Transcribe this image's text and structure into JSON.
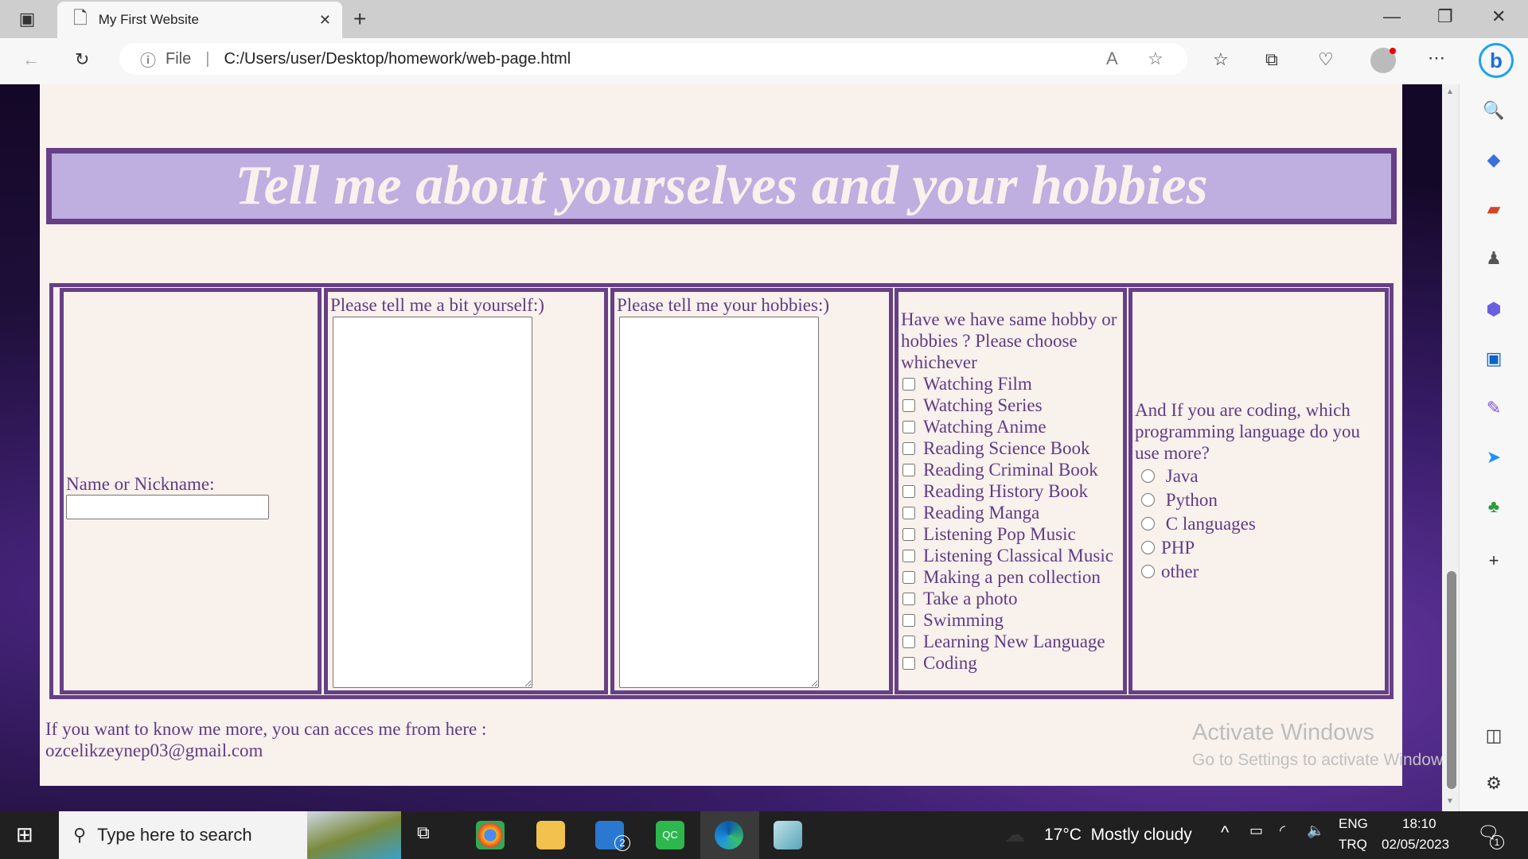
{
  "browser": {
    "tab_title": "My First Website",
    "address_prefix": "File",
    "url": "C:/Users/user/Desktop/homework/web-page.html"
  },
  "page": {
    "heading": "Tell me about yourselves and your hobbies",
    "name_label": "Name or Nickname:",
    "name_value": "",
    "about_label": "Please tell me a bit yourself:)",
    "hobbies_label": "Please tell me your hobbies:)",
    "checkbox_prompt": "Have we have same hobby or hobbies ? Please choose whichever",
    "checkboxes": [
      "Watching Film",
      "Watching Series",
      "Watching Anime",
      "Reading Science Book",
      "Reading Criminal Book",
      "Reading History Book",
      "Reading Manga",
      "Listening Pop Music",
      "Listening Classical Music",
      "Making a pen collection",
      "Take a photo",
      "Swimming",
      "Learning New Language",
      "Coding"
    ],
    "radio_prompt": "And If you are coding, which programming language do you use more?",
    "radios": [
      " Java",
      " Python",
      " C languages",
      "PHP",
      "other"
    ],
    "footer_line1": "If you want to know me more, you can acces me from here :",
    "footer_email": "ozcelikzeynep03@gmail.com"
  },
  "watermark": {
    "title": "Activate Windows",
    "subtitle": "Go to Settings to activate Windows."
  },
  "taskbar": {
    "search_placeholder": "Type here to search",
    "weather": "17°C  Mostly cloudy",
    "lang1": "ENG",
    "lang2": "TRQ",
    "time": "18:10",
    "date": "02/05/2023",
    "mail_badge": "2",
    "notif_badge": "1"
  },
  "colors": {
    "accent": "#663f86",
    "header_fill": "#bfaee0",
    "page_bg": "#f9f1ec",
    "text": "#5f3b86"
  }
}
